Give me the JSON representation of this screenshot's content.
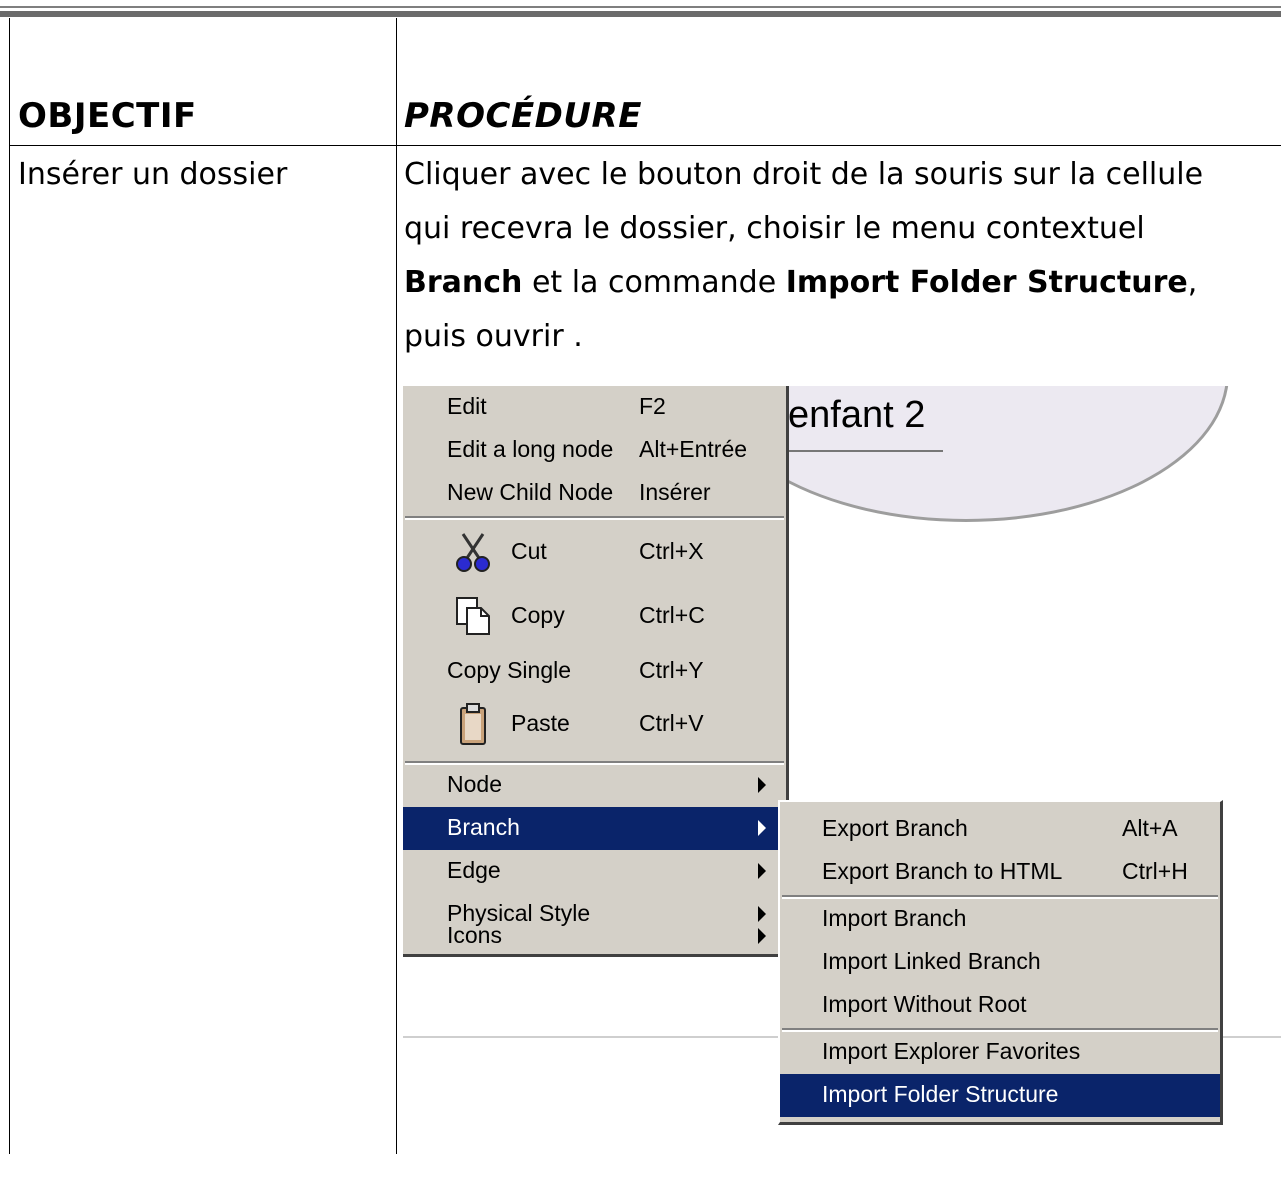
{
  "table": {
    "header_objectif": "OBJECTIF",
    "header_procedure": "PROCÉDURE",
    "row_objectif": "Insérer un dossier",
    "procedure": {
      "line1": "Cliquer avec le bouton droit de la souris sur la cellule",
      "line2": "qui recevra le dossier, choisir le menu contextuel",
      "bold1": "Branch",
      "mid": " et la commande ",
      "bold2": "Import Folder Structure",
      "comma": ",",
      "line4": "puis ouvrir ."
    }
  },
  "screenshot": {
    "node_label": "enfant 2",
    "menu": [
      {
        "label": "Edit",
        "key": "F2"
      },
      {
        "label": "Edit a long node",
        "key": "Alt+Entrée"
      },
      {
        "label": "New Child Node",
        "key": "Insérer"
      },
      {
        "label": "Cut",
        "key": "Ctrl+X",
        "icon": "scissors-icon"
      },
      {
        "label": "Copy",
        "key": "Ctrl+C",
        "icon": "copy-icon"
      },
      {
        "label": "Copy Single",
        "key": "Ctrl+Y"
      },
      {
        "label": "Paste",
        "key": "Ctrl+V",
        "icon": "clipboard-icon"
      },
      {
        "label": "Node"
      },
      {
        "label": "Branch"
      },
      {
        "label": "Edge"
      },
      {
        "label": "Physical Style"
      },
      {
        "label": "Icons"
      }
    ],
    "submenu": [
      {
        "label": "Export Branch",
        "key": "Alt+A"
      },
      {
        "label": "Export Branch to HTML",
        "key": "Ctrl+H"
      },
      {
        "label": "Import Branch"
      },
      {
        "label": "Import Linked Branch"
      },
      {
        "label": "Import Without Root"
      },
      {
        "label": "Import Explorer Favorites"
      },
      {
        "label": "Import Folder Structure"
      }
    ],
    "highlight_color": "#0a246a",
    "menu_bg": "#d4d0c8"
  }
}
